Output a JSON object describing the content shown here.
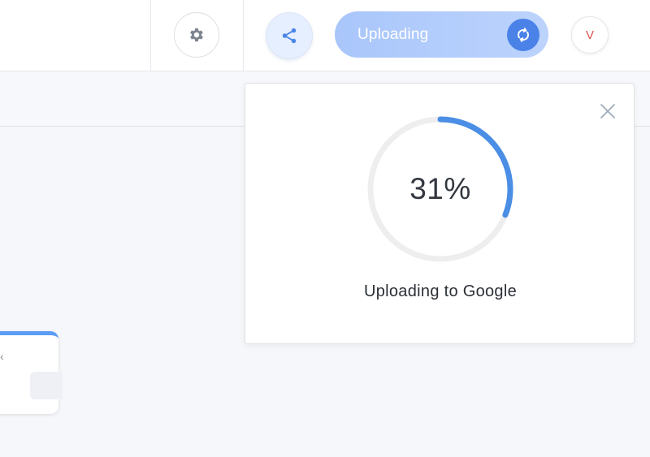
{
  "header": {
    "settings_icon": "gear-icon",
    "share_icon": "share-icon",
    "upload_button": {
      "label": "Uploading",
      "icon": "sync-icon"
    },
    "avatar_initial": "V"
  },
  "upload_popover": {
    "progress_percent": 31,
    "progress_label": "31%",
    "caption": "Uploading to Google",
    "close_icon": "close-icon"
  },
  "colors": {
    "accent": "#4a8ee5",
    "ring_track": "#eeeeee",
    "pill_background": "#b3cdfb",
    "avatar_text": "#d9534f"
  }
}
